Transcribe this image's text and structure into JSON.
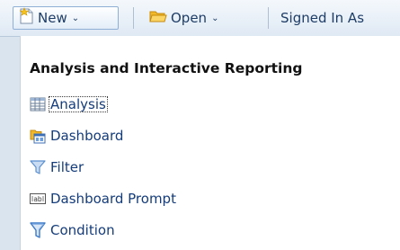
{
  "toolbar": {
    "new_label": "New",
    "open_label": "Open",
    "signed_in_label": "Signed In As"
  },
  "menu": {
    "header": "Analysis and Interactive Reporting",
    "items": [
      {
        "label": "Analysis",
        "icon": "analysis-grid-icon"
      },
      {
        "label": "Dashboard",
        "icon": "dashboard-icon"
      },
      {
        "label": "Filter",
        "icon": "filter-funnel-icon"
      },
      {
        "label": "Dashboard Prompt",
        "icon": "prompt-ab-icon"
      },
      {
        "label": "Condition",
        "icon": "condition-funnel-icon"
      }
    ]
  },
  "colors": {
    "background": "#d9e4ef",
    "link_text": "#143c7a",
    "toolbar_text": "#1e3d66",
    "folder_yellow": "#f2b829",
    "funnel_blue": "#5b8fd0"
  }
}
